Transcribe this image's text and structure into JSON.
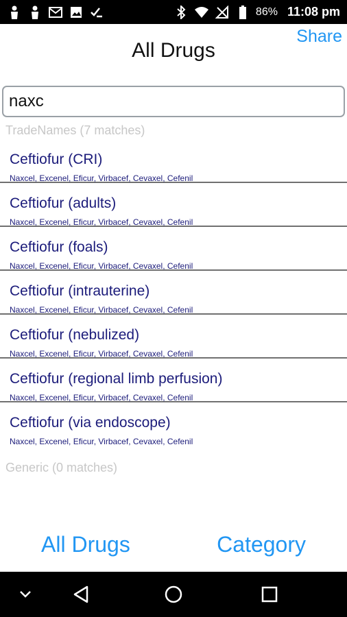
{
  "status_bar": {
    "battery": "86%",
    "time": "11:08 pm"
  },
  "header": {
    "title": "All Drugs",
    "share_label": "Share"
  },
  "search": {
    "value": "naxc"
  },
  "sections": {
    "tradenames_label": "TradeNames (7 matches)",
    "generic_label": "Generic (0 matches)"
  },
  "results": [
    {
      "title": "Ceftiofur (CRI)",
      "subtitle": "Naxcel, Excenel, Eficur, Virbacef, Cevaxel, Cefenil"
    },
    {
      "title": "Ceftiofur (adults)",
      "subtitle": "Naxcel, Excenel, Eficur, Virbacef, Cevaxel, Cefenil"
    },
    {
      "title": "Ceftiofur (foals)",
      "subtitle": "Naxcel, Excenel, Eficur, Virbacef, Cevaxel, Cefenil"
    },
    {
      "title": "Ceftiofur (intrauterine)",
      "subtitle": "Naxcel, Excenel, Eficur, Virbacef, Cevaxel, Cefenil"
    },
    {
      "title": "Ceftiofur (nebulized)",
      "subtitle": "Naxcel, Excenel, Eficur, Virbacef, Cevaxel, Cefenil"
    },
    {
      "title": "Ceftiofur (regional limb perfusion)",
      "subtitle": "Naxcel, Excenel, Eficur, Virbacef, Cevaxel, Cefenil"
    },
    {
      "title": "Ceftiofur (via endoscope)",
      "subtitle": "Naxcel, Excenel, Eficur, Virbacef, Cevaxel, Cefenil"
    }
  ],
  "bottom_tabs": {
    "all_drugs": "All Drugs",
    "category": "Category"
  },
  "colors": {
    "accent": "#2196f3",
    "item_text": "#1b1b7a",
    "section_label": "#c7c7c7"
  }
}
